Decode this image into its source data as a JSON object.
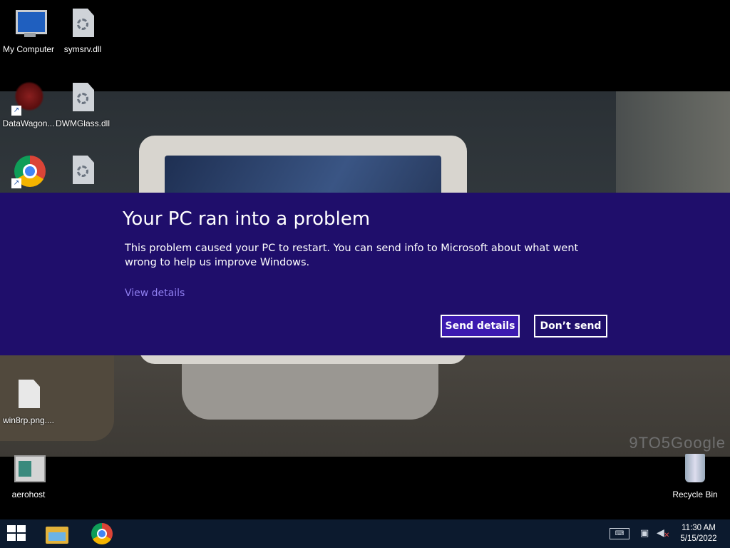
{
  "desktop": {
    "icons": [
      {
        "label": "My Computer",
        "icon": "computer-icon"
      },
      {
        "label": "symsrv.dll",
        "icon": "dll-file-icon"
      },
      {
        "label": "DataWagon...",
        "icon": "web-shortcut-icon"
      },
      {
        "label": "DWMGlass.dll",
        "icon": "dll-file-icon"
      },
      {
        "label": "",
        "icon": "chrome-icon"
      },
      {
        "label": "",
        "icon": "dll-file-icon"
      },
      {
        "label": "win8rp.png....",
        "icon": "file-icon"
      },
      {
        "label": "aerohost",
        "icon": "app-icon"
      },
      {
        "label": "Recycle Bin",
        "icon": "recycle-bin-icon"
      }
    ],
    "wallpaper_watermark": "9TO5Google"
  },
  "error_dialog": {
    "title": "Your PC ran into a problem",
    "message": "This problem caused your PC to restart. You can send info to Microsoft about what went wrong to help us improve Windows.",
    "view_details_link": "View details",
    "send_button": "Send details",
    "dont_send_button": "Don’t send",
    "background_color": "#1f0e6b",
    "primary_button_color": "#3c1ab0",
    "link_color": "#8f7ff0"
  },
  "taskbar": {
    "pinned": [
      "start-icon",
      "file-explorer-icon",
      "chrome-icon"
    ],
    "tray": [
      "keyboard-icon",
      "network-icon",
      "volume-muted-icon"
    ],
    "time": "11:30 AM",
    "date": "5/15/2022"
  }
}
